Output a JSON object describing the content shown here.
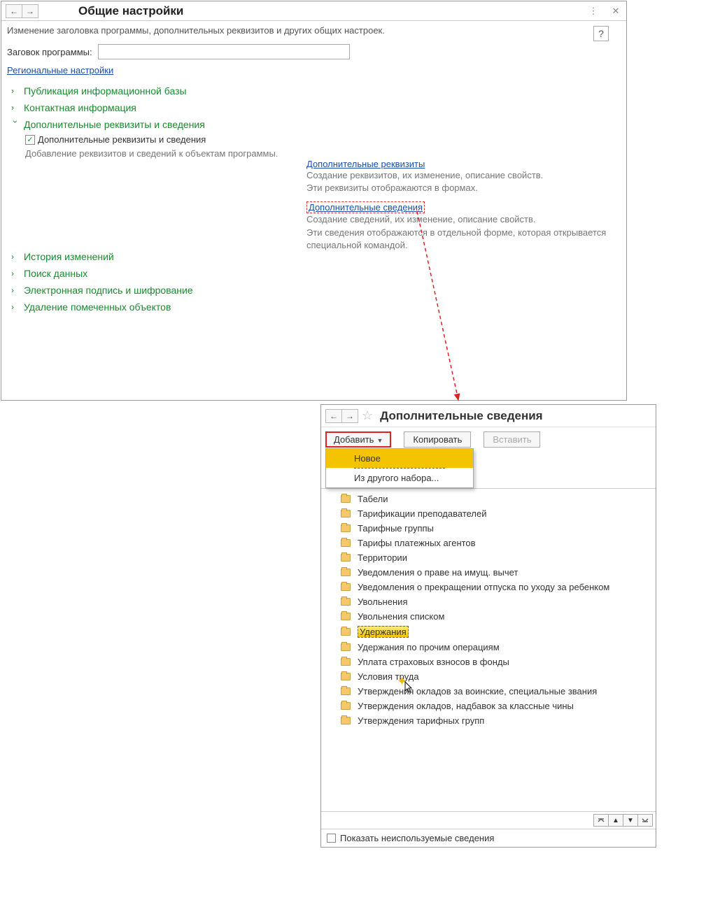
{
  "top": {
    "title": "Общие настройки",
    "subtitle": "Изменение заголовка программы, дополнительных реквизитов и других общих настроек.",
    "field_label": "Заговок программы:",
    "regional_link": "Региональные настройки",
    "sections": {
      "s1": "Публикация информационной базы",
      "s2": "Контактная информация",
      "s3": "Дополнительные реквизиты и сведения",
      "s4": "История изменений",
      "s5": "Поиск данных",
      "s6": "Электронная подпись и шифрование",
      "s7": "Удаление помеченных объектов"
    },
    "checkbox_label": "Дополнительные реквизиты и сведения",
    "checkbox_desc": "Добавление реквизитов и сведений к объектам программы.",
    "right": {
      "link1": "Дополнительные реквизиты",
      "desc1a": "Создание реквизитов, их изменение, описание свойств.",
      "desc1b": "Эти реквизиты отображаются в формах.",
      "link2": "Дополнительные сведения",
      "desc2a": "Создание сведений, их изменение, описание свойств.",
      "desc2b": "Эти сведения отображаются в отдельной форме, которая открывается специальной командой."
    },
    "help": "?"
  },
  "bottom": {
    "title": "Дополнительные сведения",
    "btn_add": "Добавить",
    "btn_copy": "Копировать",
    "btn_paste": "Вставить",
    "dd1": "Новое",
    "dd2": "Из другого набора...",
    "items": [
      "Табели",
      "Тарификации преподавателей",
      "Тарифные группы",
      "Тарифы платежных агентов",
      "Территории",
      "Уведомления о праве на имущ. вычет",
      "Уведомления о прекращении отпуска по уходу за ребенком",
      "Увольнения",
      "Увольнения списком",
      "Удержания",
      "Удержания по прочим операциям",
      "Уплата страховых взносов в фонды",
      "Условия труда",
      "Утверждения окладов за воинские, специальные звания",
      "Утверждения окладов, надбавок за классные чины",
      "Утверждения тарифных групп"
    ],
    "footer_chk": "Показать неиспользуемые сведения"
  }
}
